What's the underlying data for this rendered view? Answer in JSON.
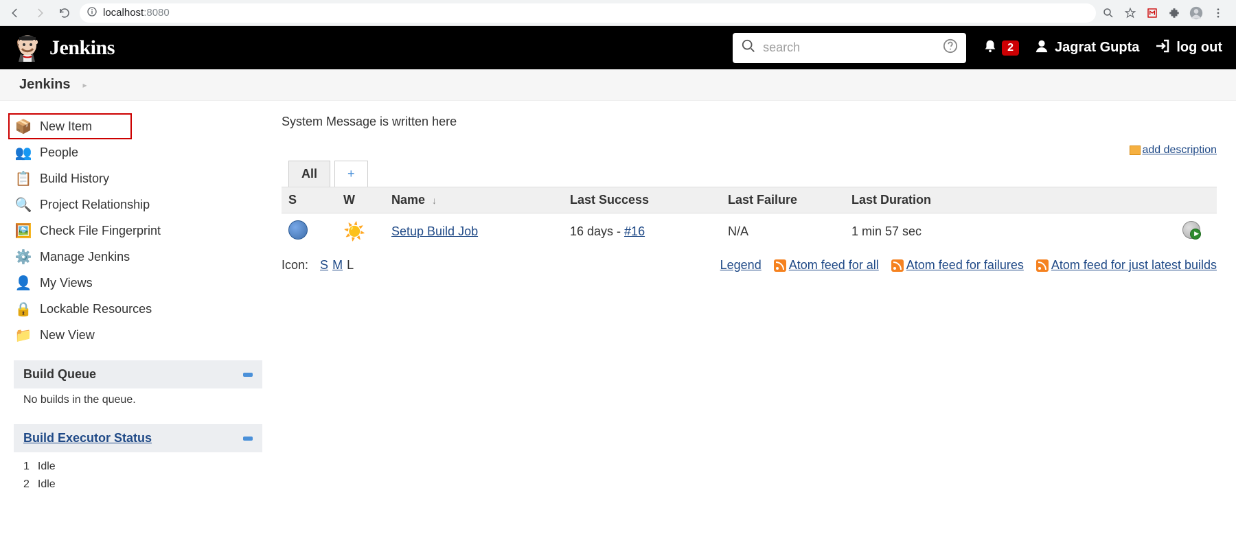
{
  "browser": {
    "url_host": "localhost",
    "url_port": ":8080"
  },
  "header": {
    "brand": "Jenkins",
    "search_placeholder": "search",
    "notif_count": "2",
    "username": "Jagrat Gupta",
    "logout_label": "log out"
  },
  "breadcrumb": {
    "root": "Jenkins"
  },
  "sidebar": {
    "items": [
      {
        "label": "New Item",
        "icon": "📦",
        "highlighted": true
      },
      {
        "label": "People",
        "icon": "👥"
      },
      {
        "label": "Build History",
        "icon": "📋"
      },
      {
        "label": "Project Relationship",
        "icon": "🔍"
      },
      {
        "label": "Check File Fingerprint",
        "icon": "🖼️"
      },
      {
        "label": "Manage Jenkins",
        "icon": "⚙️"
      },
      {
        "label": "My Views",
        "icon": "👤"
      },
      {
        "label": "Lockable Resources",
        "icon": "🔒"
      },
      {
        "label": "New View",
        "icon": "📁"
      }
    ],
    "build_queue": {
      "title": "Build Queue",
      "message": "No builds in the queue."
    },
    "executor_status": {
      "title": "Build Executor Status",
      "executors": [
        {
          "num": "1",
          "state": "Idle"
        },
        {
          "num": "2",
          "state": "Idle"
        }
      ]
    }
  },
  "main": {
    "system_message": "System Message is written here",
    "add_description_label": "add description",
    "tabs": {
      "all": "All",
      "add": "+"
    },
    "table": {
      "headers": {
        "s": "S",
        "w": "W",
        "name": "Name",
        "last_success": "Last Success",
        "last_failure": "Last Failure",
        "last_duration": "Last Duration"
      },
      "rows": [
        {
          "status": "blue",
          "weather": "☀️",
          "name": "Setup Build Job",
          "last_success_prefix": "16 days - ",
          "last_success_build": "#16",
          "last_failure": "N/A",
          "last_duration": "1 min 57 sec"
        }
      ]
    },
    "icon_size": {
      "label": "Icon:",
      "s": "S",
      "m": "M",
      "l": "L"
    },
    "legend_label": "Legend",
    "feed_all": "Atom feed for all",
    "feed_failures": "Atom feed for failures",
    "feed_latest": "Atom feed for just latest builds"
  }
}
